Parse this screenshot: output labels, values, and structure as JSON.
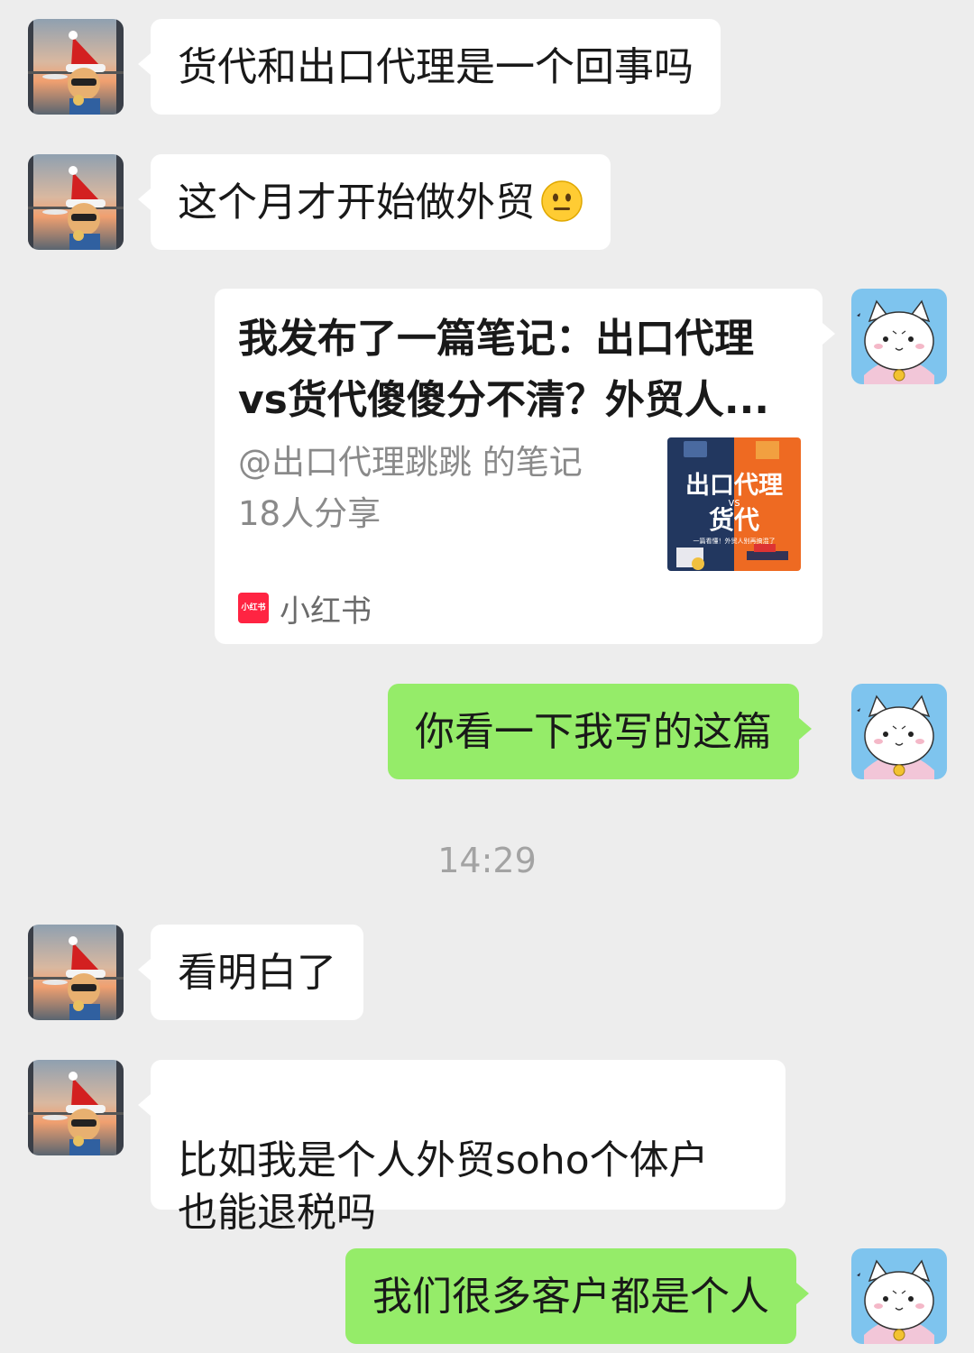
{
  "messages": [
    {
      "text": "货代和出口代理是一个回事吗"
    },
    {
      "text": "这个月才开始做外贸",
      "emoji": "neutral-face-emoji"
    },
    {
      "card": {
        "title_line1": "我发布了一篇笔记：出口代理",
        "title_line2": "vs货代傻傻分不清？外贸人...",
        "author": "@出口代理跳跳 的笔记",
        "shares": "18人分享",
        "thumbnail": {
          "line1": "出口代理",
          "vs": "vs",
          "line2": "货代",
          "sub": "一篇看懂！外贸人别再搞混了"
        },
        "source_logo": "小红书",
        "source_name": "小红书"
      }
    },
    {
      "text": "你看一下我写的这篇"
    },
    {
      "text": "看明白了"
    },
    {
      "text": "比如我是个人外贸soho个体户\n也能退税吗"
    },
    {
      "text": "我们很多客户都是个人"
    }
  ],
  "timestamp": "14:29",
  "colors": {
    "background": "#ededed",
    "incoming_bubble": "#ffffff",
    "outgoing_bubble": "#95ec69",
    "brand_red": "#ff2442"
  }
}
